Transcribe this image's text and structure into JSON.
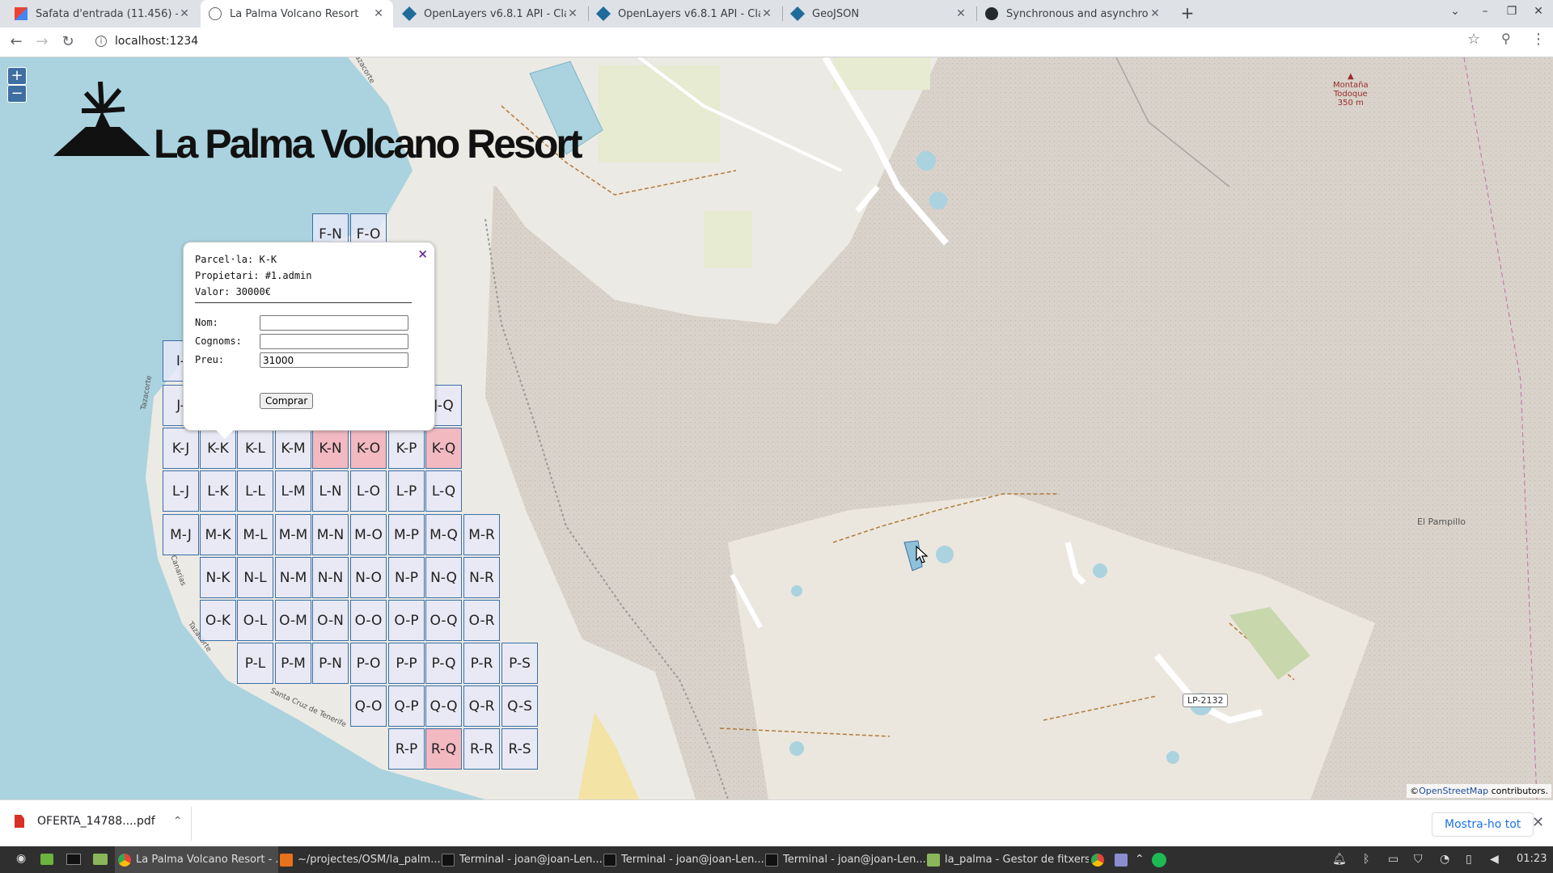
{
  "browser": {
    "tabs": [
      {
        "label": "Safata d'entrada (11.456) - joa",
        "icon": "gmail-icon",
        "active": false
      },
      {
        "label": "La Palma Volcano Resort",
        "icon": "globe-icon",
        "active": true
      },
      {
        "label": "OpenLayers v6.8.1 API - Class",
        "icon": "openlayers-icon",
        "active": false
      },
      {
        "label": "OpenLayers v6.8.1 API - Class",
        "icon": "openlayers-icon",
        "active": false
      },
      {
        "label": "GeoJSON",
        "icon": "openlayers-icon",
        "active": false
      },
      {
        "label": "Synchronous and asynchronou",
        "icon": "github-icon",
        "active": false
      }
    ],
    "url": "localhost:1234"
  },
  "map": {
    "logo_text": "La Palma Volcano Resort",
    "labels": {
      "peak": [
        "Montaña",
        "Todoque",
        "350 m"
      ],
      "el_pampillo": "El Pampillo",
      "road": "LP-2132",
      "tazacorte": "Tazacorte",
      "santa_cruz": "Santa Cruz de Tenerife",
      "canarias": "Canarias"
    },
    "attribution": {
      "prefix": "©",
      "link": "OpenStreetMap",
      "suffix": " contributors."
    },
    "cells": [
      {
        "label": "F-N",
        "sold": false
      },
      {
        "label": "F-O",
        "sold": false
      },
      {
        "label": "I-",
        "sold": false
      },
      {
        "label": "J-",
        "sold": false
      },
      {
        "label": "J-Q",
        "sold": false
      },
      {
        "label": "K-J",
        "sold": false
      },
      {
        "label": "K-K",
        "sold": false
      },
      {
        "label": "K-L",
        "sold": false
      },
      {
        "label": "K-M",
        "sold": false
      },
      {
        "label": "K-N",
        "sold": true
      },
      {
        "label": "K-O",
        "sold": true
      },
      {
        "label": "K-P",
        "sold": false
      },
      {
        "label": "K-Q",
        "sold": true
      },
      {
        "label": "L-J",
        "sold": false
      },
      {
        "label": "L-K",
        "sold": false
      },
      {
        "label": "L-L",
        "sold": false
      },
      {
        "label": "L-M",
        "sold": false
      },
      {
        "label": "L-N",
        "sold": false
      },
      {
        "label": "L-O",
        "sold": false
      },
      {
        "label": "L-P",
        "sold": false
      },
      {
        "label": "L-Q",
        "sold": false
      },
      {
        "label": "M-J",
        "sold": false
      },
      {
        "label": "M-K",
        "sold": false
      },
      {
        "label": "M-L",
        "sold": false
      },
      {
        "label": "M-M",
        "sold": false
      },
      {
        "label": "M-N",
        "sold": false
      },
      {
        "label": "M-O",
        "sold": false
      },
      {
        "label": "M-P",
        "sold": false
      },
      {
        "label": "M-Q",
        "sold": false
      },
      {
        "label": "M-R",
        "sold": false
      },
      {
        "label": "N-K",
        "sold": false
      },
      {
        "label": "N-L",
        "sold": false
      },
      {
        "label": "N-M",
        "sold": false
      },
      {
        "label": "N-N",
        "sold": false
      },
      {
        "label": "N-O",
        "sold": false
      },
      {
        "label": "N-P",
        "sold": false
      },
      {
        "label": "N-Q",
        "sold": false
      },
      {
        "label": "N-R",
        "sold": false
      },
      {
        "label": "O-K",
        "sold": false
      },
      {
        "label": "O-L",
        "sold": false
      },
      {
        "label": "O-M",
        "sold": false
      },
      {
        "label": "O-N",
        "sold": false
      },
      {
        "label": "O-O",
        "sold": false
      },
      {
        "label": "O-P",
        "sold": false
      },
      {
        "label": "O-Q",
        "sold": false
      },
      {
        "label": "O-R",
        "sold": false
      },
      {
        "label": "P-L",
        "sold": false
      },
      {
        "label": "P-M",
        "sold": false
      },
      {
        "label": "P-N",
        "sold": false
      },
      {
        "label": "P-O",
        "sold": false
      },
      {
        "label": "P-P",
        "sold": false
      },
      {
        "label": "P-Q",
        "sold": false
      },
      {
        "label": "P-R",
        "sold": false
      },
      {
        "label": "P-S",
        "sold": false
      },
      {
        "label": "Q-O",
        "sold": false
      },
      {
        "label": "Q-P",
        "sold": false
      },
      {
        "label": "Q-Q",
        "sold": false
      },
      {
        "label": "Q-R",
        "sold": false
      },
      {
        "label": "Q-S",
        "sold": false
      },
      {
        "label": "R-P",
        "sold": false
      },
      {
        "label": "R-Q",
        "sold": true
      },
      {
        "label": "R-R",
        "sold": false
      },
      {
        "label": "R-S",
        "sold": false
      }
    ]
  },
  "popup": {
    "parcel": "Parcel·la: K-K",
    "owner": "Propietari: #1.admin",
    "value": "Valor: 30000€",
    "nom_label": "Nom:",
    "nom_value": "",
    "cognoms_label": "Cognoms:",
    "cognoms_value": "",
    "preu_label": "Preu:",
    "preu_value": "31000",
    "buy_label": "Comprar",
    "close": "×"
  },
  "downloads": {
    "file": "OFERTA_14788....pdf",
    "show_all": "Mostra-ho tot"
  },
  "taskbar": {
    "items": [
      {
        "label": "La Palma Volcano Resort - ...",
        "icon": "chrome-icon",
        "active": true
      },
      {
        "label": "~/projectes/OSM/la_palm...",
        "icon": "editor-icon",
        "active": false
      },
      {
        "label": "Terminal - joan@joan-Len...",
        "icon": "terminal-icon",
        "active": false
      },
      {
        "label": "Terminal - joan@joan-Len...",
        "icon": "terminal-icon",
        "active": false
      },
      {
        "label": "Terminal - joan@joan-Len...",
        "icon": "terminal-icon",
        "active": false
      },
      {
        "label": "la_palma - Gestor de fitxers",
        "icon": "folder-icon",
        "active": false
      }
    ],
    "clock": "01:23"
  }
}
